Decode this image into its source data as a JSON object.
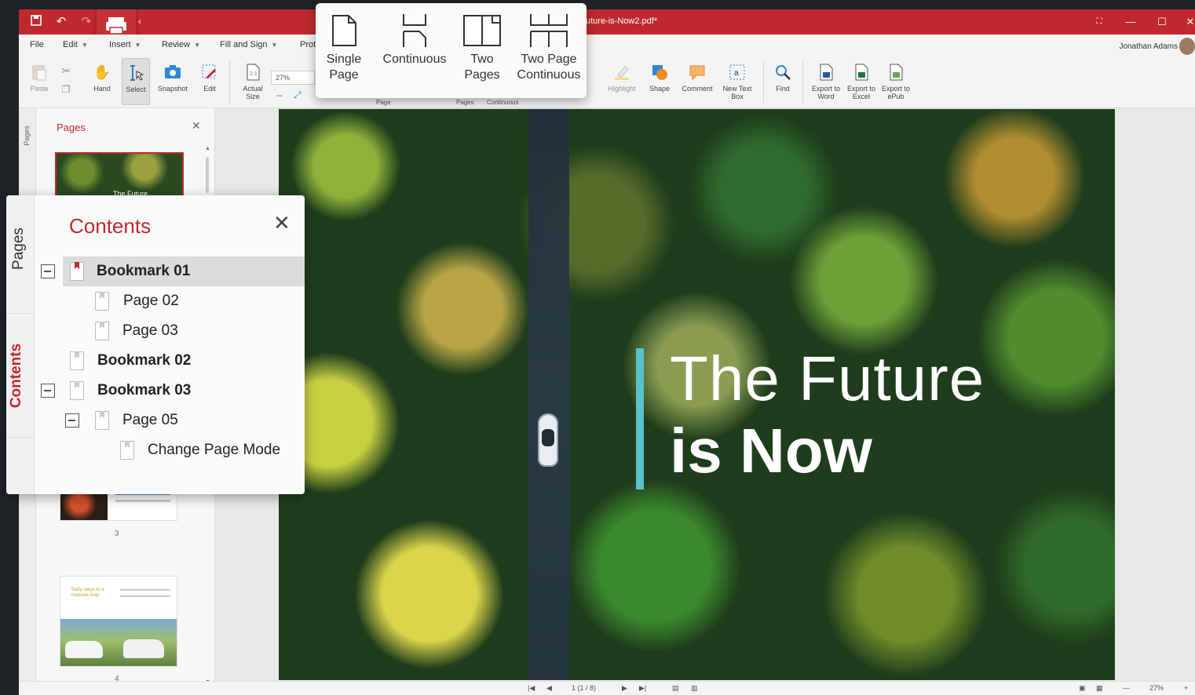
{
  "titlebar": {
    "doc_title": "uture-is-Now2.pdf*"
  },
  "menu": {
    "items": [
      "File",
      "Edit",
      "Insert",
      "Review",
      "Fill and Sign",
      "Prot"
    ],
    "user": "Jonathan Adams"
  },
  "ribbon": {
    "paste": "Paste",
    "hand": "Hand",
    "select": "Select",
    "snapshot": "Snapshot",
    "edit": "Edit",
    "actual_size": "Actual Size",
    "zoom": "27%",
    "page": "Page",
    "pages": "Pages",
    "continuous": "Continuous",
    "highlight": "Highlight",
    "shape": "Shape",
    "comment": "Comment",
    "new_text_box": "New Text Box",
    "find": "Find",
    "export_word": "Export to Word",
    "export_excel": "Export to Excel",
    "export_epub": "Export to ePub"
  },
  "view_modes": {
    "single_page": "Single Page",
    "continuous": "Continuous",
    "two_pages": "Two Pages",
    "two_page_continuous": "Two Page Continuous"
  },
  "pages_panel": {
    "title": "Pages",
    "rail_pages": "Pages",
    "thumb_nums": [
      "3",
      "4"
    ],
    "thumb1_text": "The Future",
    "thumb4_text": "Baby steps to a massive leap"
  },
  "contents_panel": {
    "title": "Contents",
    "tab_pages": "Pages",
    "tab_contents": "Contents",
    "rows": [
      {
        "label": "Bookmark 01",
        "bold": true,
        "expanded": true,
        "selected": true
      },
      {
        "label": "Page 02",
        "bold": false
      },
      {
        "label": "Page 03",
        "bold": false
      },
      {
        "label": "Bookmark 02",
        "bold": true
      },
      {
        "label": "Bookmark 03",
        "bold": true,
        "expanded": true
      },
      {
        "label": "Page 05",
        "bold": false,
        "expanded": true
      },
      {
        "label": "Change Page Mode",
        "bold": false
      }
    ]
  },
  "document": {
    "line1": "The Future",
    "line2": "is Now",
    "accent": "#59c2cc"
  },
  "status": {
    "page_indicator": "1 (1 / 8)",
    "zoom": "27%"
  },
  "colors": {
    "brand": "#c0282e"
  }
}
